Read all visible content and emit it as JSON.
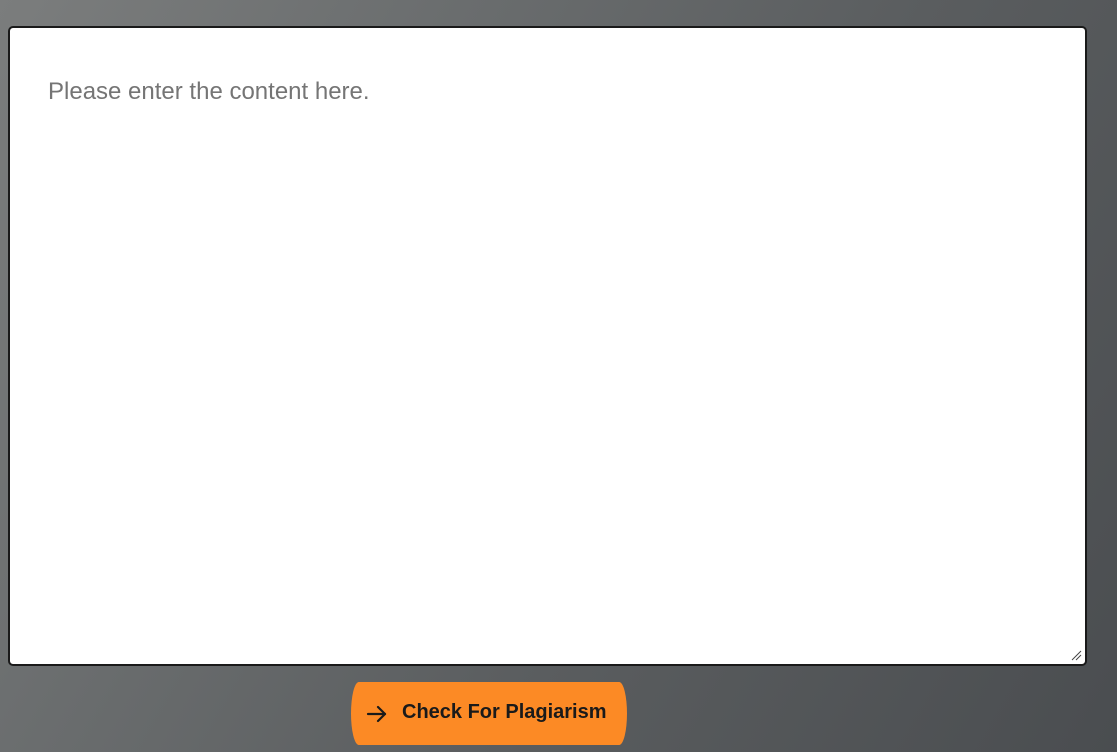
{
  "editor": {
    "placeholder": "Please enter the content here."
  },
  "actions": {
    "check_label": "Check For Plagiarism",
    "check_icon": "arrow-right-icon"
  },
  "colors": {
    "button": "#fc8a25",
    "editor_bg": "#ffffff",
    "placeholder_text": "#757575"
  }
}
